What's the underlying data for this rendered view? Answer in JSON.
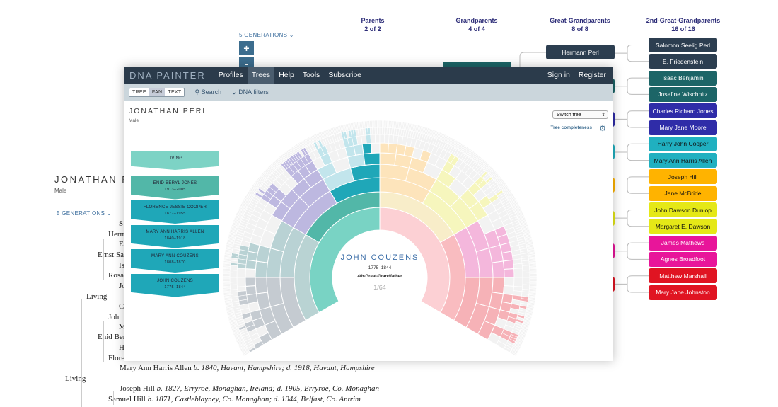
{
  "text_tree": {
    "title": "JONATHAN PERL",
    "sex": "Male",
    "generations": "5 GENERATIONS",
    "nodes": [
      "S",
      "Herm",
      "E",
      "Ernst Sal",
      "Is",
      "Rosa",
      "Jo",
      "Living",
      "C",
      "John",
      "M",
      "Enid Ber",
      "H",
      "Flore"
    ],
    "full_rows": [
      {
        "name": "Mary Ann Harris Allen",
        "detail": "b. 1840, Havant, Hampshire; d. 1918, Havant, Hampshire"
      },
      {
        "name": "Living",
        "detail": ""
      },
      {
        "name": "Joseph Hill",
        "detail": "b. 1827, Erryroe, Monaghan, Ireland; d. 1905, Erryroe, Co. Monaghan"
      },
      {
        "name": "Samuel Hill",
        "detail": "b. 1871, Castleblayney, Co. Monaghan; d. 1944, Belfast, Co. Antrim"
      }
    ]
  },
  "pedigree": {
    "generations": "5 GENERATIONS",
    "zoom_in": "+",
    "zoom_out": "-",
    "columns": [
      {
        "title": "Parents",
        "count": "2 of 2"
      },
      {
        "title": "Grandparents",
        "count": "4 of 4"
      },
      {
        "title": "Great-Grandparents",
        "count": "8 of 8"
      },
      {
        "title": "2nd-Great-Grandparents",
        "count": "16 of 16"
      }
    ],
    "great_grandparent": "Hermann Perl",
    "second_great": [
      {
        "name": "Salomon Seelig Perl",
        "color": "#2c3e50",
        "text": "#fff"
      },
      {
        "name": "E. Friedenstein",
        "color": "#2c3e50",
        "text": "#fff"
      },
      {
        "name": "Isaac Benjamin",
        "color": "#1c6567",
        "text": "#fff"
      },
      {
        "name": "Josefine Wischnitz",
        "color": "#1c6567",
        "text": "#fff"
      },
      {
        "name": "Charles Richard Jones",
        "color": "#2f2ca8",
        "text": "#fff"
      },
      {
        "name": "Mary Jane Moore",
        "color": "#2f2ca8",
        "text": "#fff"
      },
      {
        "name": "Harry John Cooper",
        "color": "#20b0c0",
        "text": "#111"
      },
      {
        "name": "Mary Ann Harris Allen",
        "color": "#20b0c0",
        "text": "#111"
      },
      {
        "name": "Joseph Hill",
        "color": "#ffb300",
        "text": "#111"
      },
      {
        "name": "Jane McBride",
        "color": "#ffb300",
        "text": "#111"
      },
      {
        "name": "John Dawson Dunlop",
        "color": "#e5e817",
        "text": "#111"
      },
      {
        "name": "Margaret E. Dawson",
        "color": "#e5e817",
        "text": "#111"
      },
      {
        "name": "James Mathews",
        "color": "#e8159a",
        "text": "#fff"
      },
      {
        "name": "Agnes Broadfoot",
        "color": "#e8159a",
        "text": "#fff"
      },
      {
        "name": "Matthew Marshall",
        "color": "#e01422",
        "text": "#fff"
      },
      {
        "name": "Mary Jane Johnston",
        "color": "#e01422",
        "text": "#fff"
      }
    ],
    "gg_colors": [
      "#2c3e50",
      "#1c6567",
      "#2f2ca8",
      "#20b0c0",
      "#ffb300",
      "#e5e817",
      "#e8159a",
      "#e01422"
    ]
  },
  "app": {
    "logo": "DNA PAINTER",
    "nav": [
      "Profiles",
      "Trees",
      "Help",
      "Tools",
      "Subscribe"
    ],
    "active_nav": "Trees",
    "sign_in": "Sign in",
    "register": "Register",
    "views": [
      "TREE",
      "FAN",
      "TEXT"
    ],
    "active_view": "FAN",
    "search": "Search",
    "dna_filters": "DNA filters",
    "person_name": "JONATHAN PERL",
    "person_sex": "Male",
    "switch_tree": "Switch tree",
    "tree_completeness": "Tree completeness",
    "lineage": [
      {
        "name": "LIVING",
        "dates": "",
        "color": "#7dd3c5"
      },
      {
        "name": "ENID BERYL JONES",
        "dates": "1913–2005",
        "color": "#52b7a8"
      },
      {
        "name": "FLORENCE JESSIE COOPER",
        "dates": "1877–1955",
        "color": "#1fa7b8"
      },
      {
        "name": "MARY ANN HARRIS ALLEN",
        "dates": "1840–1918",
        "color": "#1fa7b8"
      },
      {
        "name": "MARY ANN COUZENS",
        "dates": "1808–1870",
        "color": "#1fa7b8"
      },
      {
        "name": "JOHN COUZENS",
        "dates": "1775–1844",
        "color": "#1fa7b8"
      }
    ],
    "fan": {
      "selected_name": "JOHN COUZENS",
      "selected_dates": "1775–1844",
      "relationship": "4th-Great-Grandfather",
      "count": "1/64",
      "empty_color": "#f2f2f2",
      "highlight_color": "#1fa7b8",
      "highlight_path": [
        0,
        1,
        3,
        7,
        15,
        30
      ],
      "gen1_colors": [
        "#79d3c4",
        "#fcd0d4"
      ],
      "gen2_colors": [
        "#b9d3d3",
        "#52b7a8",
        "#f8edc9",
        "#f9bcc0"
      ],
      "branches": [
        {
          "color": "#c5cbd1",
          "fill": [
            1,
            1,
            0.85,
            0.45,
            0.1
          ]
        },
        {
          "color": "#b9d2d4",
          "fill": [
            1,
            0.9,
            0.6,
            0.3,
            0.05
          ]
        },
        {
          "color": "#bdb8e0",
          "fill": [
            1,
            1,
            0.85,
            0.65,
            0.45
          ]
        },
        {
          "color": "#c2e5ec",
          "fill": [
            1,
            0.9,
            0.7,
            0.5,
            0.35
          ]
        },
        {
          "color": "#fde4bb",
          "fill": [
            0.9,
            0.6,
            0.25,
            0,
            0
          ]
        },
        {
          "color": "#f6f6bd",
          "fill": [
            1,
            0.9,
            0.7,
            0.3,
            0.1
          ]
        },
        {
          "color": "#f4b7dc",
          "fill": [
            1,
            0.6,
            0.5,
            0.2,
            0
          ]
        },
        {
          "color": "#f6b2b7",
          "fill": [
            1,
            0.9,
            0.65,
            0.5,
            0.3
          ]
        }
      ]
    }
  }
}
